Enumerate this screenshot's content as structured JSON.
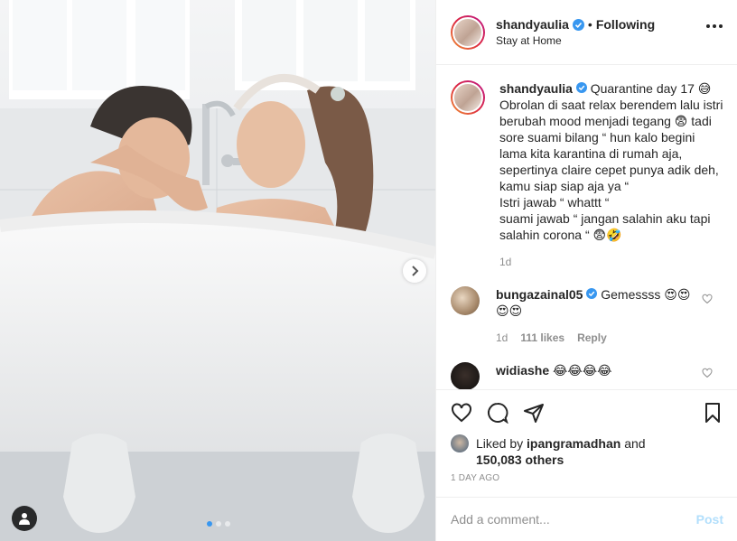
{
  "post": {
    "username": "shandyaulia",
    "separator": "•",
    "follow_state": "Following",
    "location": "Stay at Home",
    "more_icon": "more-horizontal-icon"
  },
  "caption": {
    "username": "shandyaulia",
    "text": "Quarantine day 17 😅\nObrolan di saat relax berendem lalu istri berubah mood menjadi tegang 😨 tadi sore suami bilang “ hun kalo begini lama kita karantina di rumah aja, sepertinya claire cepet punya adik deh, kamu siap siap aja ya “\nIstri jawab “ whattt “\nsuami jawab “ jangan salahin aku tapi salahin corona “ 😨🤣",
    "time": "1d"
  },
  "comments": [
    {
      "username": "bungazainal05",
      "text": "Gemessss 😍😍\n😍😍",
      "time": "1d",
      "likes": "111 likes",
      "reply": "Reply"
    },
    {
      "username": "widiashe",
      "text": "😂😂😂😂"
    }
  ],
  "likes": {
    "prefix": "Liked by",
    "user": "ipangramadhan",
    "conj": "and",
    "others": "150,083 others"
  },
  "timestamp": "1 DAY AGO",
  "add_comment": {
    "placeholder": "Add a comment...",
    "post_label": "Post"
  },
  "carousel": {
    "count": 3,
    "active": 1
  },
  "colors": {
    "link": "#3897f0",
    "post_disabled": "#b2dffc",
    "muted": "#8e8e8e",
    "verified": "#3897f0"
  }
}
